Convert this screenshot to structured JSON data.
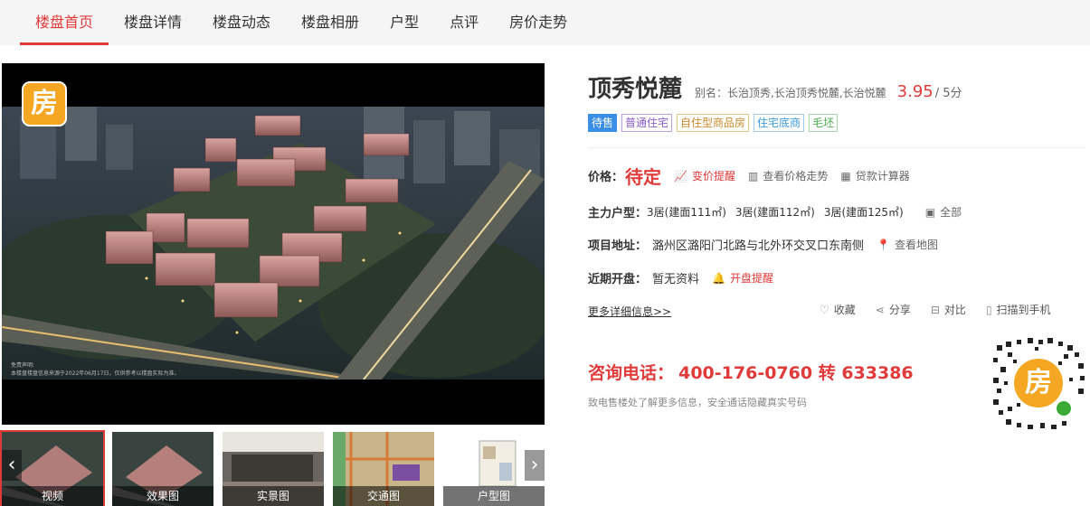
{
  "nav": {
    "items": [
      {
        "label": "楼盘首页",
        "active": true
      },
      {
        "label": "楼盘详情",
        "active": false
      },
      {
        "label": "楼盘动态",
        "active": false
      },
      {
        "label": "楼盘相册",
        "active": false
      },
      {
        "label": "户型",
        "active": false
      },
      {
        "label": "点评",
        "active": false
      },
      {
        "label": "房价走势",
        "active": false
      }
    ]
  },
  "gallery": {
    "logo_text": "房",
    "note_line1": "免责声明:",
    "note_line2": "本楼盘楼盘信息来源于2022年06月17日，仅供参考以楼盘实际为准。",
    "thumbnails": [
      {
        "label": "视频",
        "selected": true
      },
      {
        "label": "效果图",
        "selected": false
      },
      {
        "label": "实景图",
        "selected": false
      },
      {
        "label": "交通图",
        "selected": false
      },
      {
        "label": "户型图",
        "selected": false
      }
    ],
    "arrow_left": "‹",
    "arrow_right": "›"
  },
  "project": {
    "name": "顶秀悦麓",
    "alias": "别名：长治顶秀,长治顶秀悦麓,长治悦麓",
    "score": "3.95",
    "score_unit": "/ 5分",
    "tags": [
      "待售",
      "普通住宅",
      "自住型商品房",
      "住宅底商",
      "毛坯"
    ]
  },
  "price": {
    "label": "价格：",
    "value": "待定",
    "alert_link": "变价提醒",
    "trend_link": "查看价格走势",
    "calc_link": "贷款计算器"
  },
  "units": {
    "label": "主力户型：",
    "items": [
      "3居(建面111㎡)",
      "3居(建面112㎡)",
      "3居(建面125㎡)"
    ],
    "all_link": "全部"
  },
  "address": {
    "label": "项目地址：",
    "value": "潞州区潞阳门北路与北外环交叉口东南侧",
    "map_link": "查看地图"
  },
  "opening": {
    "label": "近期开盘：",
    "value": "暂无资料",
    "alert_link": "开盘提醒"
  },
  "more_link": "更多详细信息>>",
  "actions": {
    "favorite": "收藏",
    "share": "分享",
    "compare": "对比",
    "scan": "扫描到手机"
  },
  "contact": {
    "label": "咨询电话：",
    "number": "400-176-0760 转 633386",
    "note": "致电售楼处了解更多信息，安全通话隐藏真实号码"
  },
  "qr_logo_text": "房",
  "colors": {
    "accent": "#e03a3a",
    "logo": "#f5a623"
  }
}
